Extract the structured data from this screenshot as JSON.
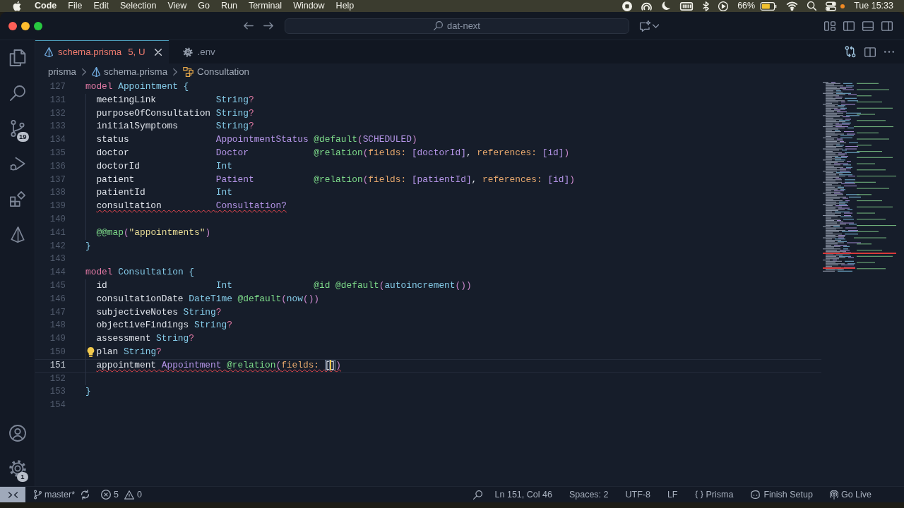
{
  "menu_bar": {
    "app_name": "Code",
    "menus": [
      "File",
      "Edit",
      "Selection",
      "View",
      "Go",
      "Run",
      "Terminal",
      "Window",
      "Help"
    ],
    "battery": "66%",
    "clock": "Tue 15:33"
  },
  "title_bar": {
    "command_center": "dat-next"
  },
  "activity_bar": {
    "source_control_badge": "19",
    "manage_badge": "1"
  },
  "tabs": [
    {
      "label": "schema.prisma",
      "problems": "5, U",
      "kind": "prisma",
      "selected": true,
      "error": true
    },
    {
      "label": ".env",
      "kind": "config",
      "selected": false,
      "error": false
    }
  ],
  "breadcrumbs": [
    {
      "label": "prisma",
      "kind": "folder"
    },
    {
      "label": "schema.prisma",
      "kind": "file"
    },
    {
      "label": "Consultation",
      "kind": "model"
    }
  ],
  "editor": {
    "lines": [
      {
        "number": "127",
        "error": false,
        "current": false,
        "hint": false,
        "tokens": [
          {
            "text": "model",
            "kind": "keyword"
          },
          {
            "text": " Appointment",
            "kind": "name"
          },
          {
            "text": " {",
            "kind": "brace"
          }
        ],
        "children": [
          {
            "number": "131",
            "error": false,
            "current": false,
            "hint": false,
            "tokens": [
              {
                "text": "meetingLink           ",
                "kind": "field"
              },
              {
                "text": "String",
                "kind": "type"
              },
              {
                "text": "?",
                "kind": "optional"
              }
            ]
          },
          {
            "number": "132",
            "error": false,
            "current": false,
            "hint": false,
            "tokens": [
              {
                "text": "purposeOfConsultation ",
                "kind": "field"
              },
              {
                "text": "String",
                "kind": "type"
              },
              {
                "text": "?",
                "kind": "optional"
              }
            ]
          },
          {
            "number": "133",
            "error": false,
            "current": false,
            "hint": false,
            "tokens": [
              {
                "text": "initialSymptoms       ",
                "kind": "field"
              },
              {
                "text": "String",
                "kind": "type"
              },
              {
                "text": "?",
                "kind": "optional"
              }
            ]
          },
          {
            "number": "134",
            "error": false,
            "current": false,
            "hint": false,
            "tokens": [
              {
                "text": "status                ",
                "kind": "field"
              },
              {
                "text": "AppointmentStatus ",
                "kind": "relation"
              },
              {
                "text": "@default",
                "kind": "attribute"
              },
              {
                "text": "(",
                "kind": "paren"
              },
              {
                "text": "SCHEDULED",
                "kind": "constant"
              },
              {
                "text": ")",
                "kind": "paren"
              }
            ]
          },
          {
            "number": "135",
            "error": false,
            "current": false,
            "hint": false,
            "tokens": [
              {
                "text": "doctor                ",
                "kind": "field"
              },
              {
                "text": "Doctor            ",
                "kind": "relation"
              },
              {
                "text": "@relation",
                "kind": "attribute"
              },
              {
                "text": "(",
                "kind": "paren"
              },
              {
                "text": "fields:",
                "kind": "argument"
              },
              {
                "text": " [doctorId]",
                "kind": "list"
              },
              {
                "text": ", ",
                "kind": "punct"
              },
              {
                "text": "references:",
                "kind": "argument"
              },
              {
                "text": " [id]",
                "kind": "list"
              },
              {
                "text": ")",
                "kind": "paren"
              }
            ]
          },
          {
            "number": "136",
            "error": false,
            "current": false,
            "hint": false,
            "tokens": [
              {
                "text": "doctorId              ",
                "kind": "field"
              },
              {
                "text": "Int",
                "kind": "type"
              }
            ]
          },
          {
            "number": "137",
            "error": false,
            "current": false,
            "hint": false,
            "tokens": [
              {
                "text": "patient               ",
                "kind": "field"
              },
              {
                "text": "Patient           ",
                "kind": "relation"
              },
              {
                "text": "@relation",
                "kind": "attribute"
              },
              {
                "text": "(",
                "kind": "paren"
              },
              {
                "text": "fields:",
                "kind": "argument"
              },
              {
                "text": " [patientId]",
                "kind": "list"
              },
              {
                "text": ", ",
                "kind": "punct"
              },
              {
                "text": "references:",
                "kind": "argument"
              },
              {
                "text": " [id]",
                "kind": "list"
              },
              {
                "text": ")",
                "kind": "paren"
              }
            ]
          },
          {
            "number": "138",
            "error": false,
            "current": false,
            "hint": false,
            "tokens": [
              {
                "text": "patientId             ",
                "kind": "field"
              },
              {
                "text": "Int",
                "kind": "type"
              }
            ]
          },
          {
            "number": "139",
            "error": true,
            "current": false,
            "hint": false,
            "tokens": [
              {
                "text": "consultation          ",
                "kind": "field"
              },
              {
                "text": "Consultation?",
                "kind": "relation"
              }
            ]
          },
          {
            "number": "140",
            "error": false,
            "current": false,
            "hint": false
          },
          {
            "number": "141",
            "error": false,
            "current": false,
            "hint": false,
            "tokens": [
              {
                "text": "@@map",
                "kind": "attribute"
              },
              {
                "text": "(",
                "kind": "paren"
              },
              {
                "text": "\"appointments\"",
                "kind": "string"
              },
              {
                "text": ")",
                "kind": "paren"
              }
            ]
          }
        ]
      },
      {
        "number": "142",
        "error": false,
        "current": false,
        "hint": false,
        "tokens": [
          {
            "text": "}",
            "kind": "brace"
          }
        ]
      },
      {
        "number": "143",
        "error": false,
        "current": false,
        "hint": false
      },
      {
        "number": "144",
        "error": false,
        "current": false,
        "hint": false,
        "tokens": [
          {
            "text": "model",
            "kind": "keyword"
          },
          {
            "text": " Consultation",
            "kind": "name"
          },
          {
            "text": " {",
            "kind": "brace"
          }
        ],
        "children": [
          {
            "number": "145",
            "error": false,
            "current": false,
            "hint": false,
            "tokens": [
              {
                "text": "id                    ",
                "kind": "field"
              },
              {
                "text": "Int               ",
                "kind": "type"
              },
              {
                "text": "@id @default",
                "kind": "attribute"
              },
              {
                "text": "(",
                "kind": "paren"
              },
              {
                "text": "autoincrement",
                "kind": "function"
              },
              {
                "text": "())",
                "kind": "paren"
              }
            ]
          },
          {
            "number": "146",
            "error": false,
            "current": false,
            "hint": false,
            "tokens": [
              {
                "text": "consultationDate ",
                "kind": "field"
              },
              {
                "text": "DateTime",
                "kind": "type"
              },
              {
                "text": " @default",
                "kind": "attribute"
              },
              {
                "text": "(",
                "kind": "paren"
              },
              {
                "text": "now",
                "kind": "function"
              },
              {
                "text": "())",
                "kind": "paren"
              }
            ]
          },
          {
            "number": "147",
            "error": false,
            "current": false,
            "hint": false,
            "tokens": [
              {
                "text": "subjectiveNotes ",
                "kind": "field"
              },
              {
                "text": "String",
                "kind": "type"
              },
              {
                "text": "?",
                "kind": "optional"
              }
            ]
          },
          {
            "number": "148",
            "error": false,
            "current": false,
            "hint": false,
            "tokens": [
              {
                "text": "objectiveFindings ",
                "kind": "field"
              },
              {
                "text": "String",
                "kind": "type"
              },
              {
                "text": "?",
                "kind": "optional"
              }
            ]
          },
          {
            "number": "149",
            "error": false,
            "current": false,
            "hint": false,
            "tokens": [
              {
                "text": "assessment ",
                "kind": "field"
              },
              {
                "text": "String",
                "kind": "type"
              },
              {
                "text": "?",
                "kind": "optional"
              }
            ]
          },
          {
            "number": "150",
            "error": false,
            "current": false,
            "hint": true,
            "tokens": [
              {
                "text": "plan ",
                "kind": "field"
              },
              {
                "text": "String",
                "kind": "type"
              },
              {
                "text": "?",
                "kind": "optional"
              }
            ]
          },
          {
            "number": "151",
            "error": true,
            "current": true,
            "hint": false,
            "tokens": [
              {
                "text": "appointment ",
                "kind": "field"
              },
              {
                "text": "Appointment ",
                "kind": "relation"
              },
              {
                "text": "@relation",
                "kind": "attribute"
              },
              {
                "text": "(",
                "kind": "paren"
              },
              {
                "text": "fields: ",
                "kind": "argument"
              },
              {
                "text": "[",
                "kind": "bracket"
              },
              {
                "kind": "cursor"
              },
              {
                "text": "]",
                "kind": "bracket"
              },
              {
                "text": ")",
                "kind": "paren"
              }
            ]
          },
          {
            "number": "152",
            "error": false,
            "current": false,
            "hint": false
          }
        ]
      },
      {
        "number": "153",
        "error": false,
        "current": false,
        "hint": false,
        "tokens": [
          {
            "text": "}",
            "kind": "brace"
          }
        ]
      },
      {
        "number": "154",
        "error": false,
        "current": false,
        "hint": false
      }
    ]
  },
  "status_bar": {
    "branch": "master*",
    "errors": "5",
    "warnings": "0",
    "items": [
      {
        "text": "Ln 151, Col 46",
        "kind": "plain"
      },
      {
        "text": "Spaces: 2",
        "kind": "plain"
      },
      {
        "text": "UTF-8",
        "kind": "plain"
      },
      {
        "text": "LF",
        "kind": "plain"
      },
      {
        "text": "Prisma",
        "kind": "language"
      },
      {
        "text": "Finish Setup",
        "kind": "copilot"
      },
      {
        "text": "Go Live",
        "kind": "live"
      }
    ]
  }
}
